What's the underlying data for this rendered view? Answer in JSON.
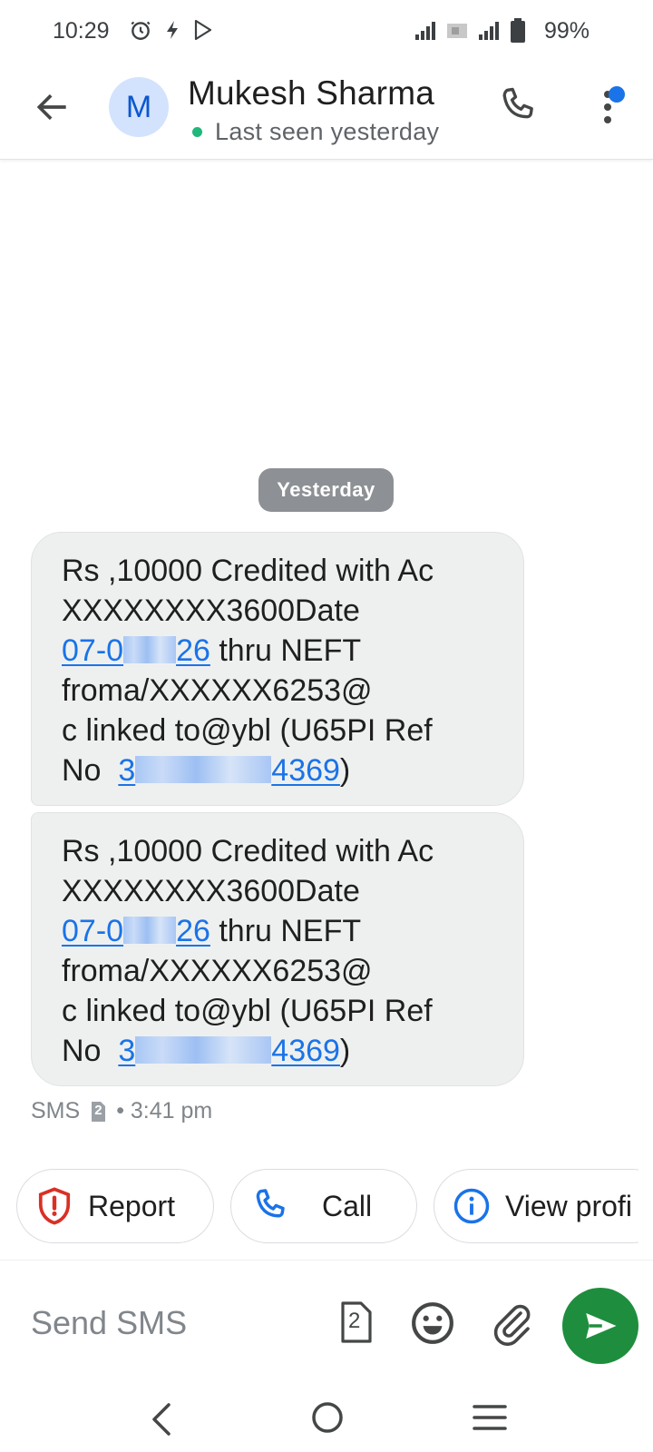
{
  "status_bar": {
    "time": "10:29",
    "battery": "99%"
  },
  "header": {
    "avatar_letter": "M",
    "contact_name": "Mukesh Sharma",
    "last_seen": "Last seen yesterday"
  },
  "date_chip": "Yesterday",
  "messages": [
    {
      "line1": "Rs ,10000 Credited with Ac",
      "line2": "XXXXXXXX3600Date",
      "date_start": "07-0",
      "date_end": "26",
      "line3_rest": " thru NEFT",
      "line4": "froma/XXXXXX6253@",
      "line5": "c linked to@ybl (U65PI Ref",
      "ref_prefix": "No  ",
      "ref_start": "3",
      "ref_end": "4369",
      "ref_suffix": ")"
    },
    {
      "line1": "Rs ,10000 Credited with Ac",
      "line2": "XXXXXXXX3600Date",
      "date_start": "07-0",
      "date_end": "26",
      "line3_rest": " thru NEFT",
      "line4": "froma/XXXXXX6253@",
      "line5": "c linked to@ybl (U65PI Ref",
      "ref_prefix": "No  ",
      "ref_start": "3",
      "ref_end": "4369",
      "ref_suffix": ")"
    }
  ],
  "meta": {
    "channel": "SMS",
    "sim": "2",
    "time": "• 3:41 pm"
  },
  "chips": {
    "report": "Report",
    "call": "Call",
    "view_profile": "View profi"
  },
  "composer": {
    "placeholder": "Send SMS",
    "sim_number": "2"
  },
  "colors": {
    "accent_blue": "#1a73e8",
    "send_green": "#1e8e3e",
    "report_red": "#d93025",
    "online_green": "#1fb87a",
    "avatar_bg": "#d3e3fd"
  },
  "icons": {
    "back": "arrow-left-icon",
    "call": "phone-icon",
    "menu": "more-vert-icon",
    "report": "shield-alert-icon",
    "info": "info-icon",
    "emoji": "emoji-icon",
    "attach": "paperclip-icon",
    "send": "send-icon"
  }
}
